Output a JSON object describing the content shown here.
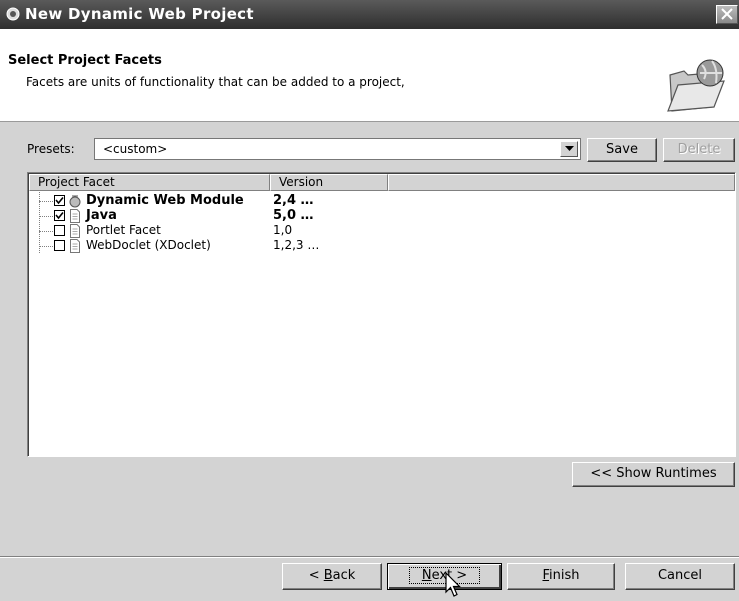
{
  "window": {
    "title": "New Dynamic Web Project"
  },
  "header": {
    "title": "Select Project Facets",
    "description": "Facets are units of functionality that can be added to a project,"
  },
  "presets": {
    "label": "Presets:",
    "value": "<custom>",
    "save_label": "Save",
    "delete_label": "Delete"
  },
  "table": {
    "columns": [
      "Project Facet",
      "Version"
    ],
    "rows": [
      {
        "name": "Dynamic Web Module",
        "version": "2,4 …",
        "checked": true,
        "bold": true,
        "icon": "web-module-icon"
      },
      {
        "name": "Java",
        "version": "5,0 …",
        "checked": true,
        "bold": true,
        "icon": "file-icon"
      },
      {
        "name": "Portlet Facet",
        "version": "1,0",
        "checked": false,
        "bold": false,
        "icon": "file-icon"
      },
      {
        "name": "WebDoclet (XDoclet)",
        "version": "1,2,3 …",
        "checked": false,
        "bold": false,
        "icon": "file-icon"
      }
    ]
  },
  "show_runtimes_label": "<< Show Runtimes",
  "buttons": {
    "back": {
      "prefix": "< ",
      "mnemonic": "B",
      "rest": "ack"
    },
    "next": {
      "mnemonic": "N",
      "rest": "ext >"
    },
    "finish": {
      "mnemonic": "F",
      "rest": "inish"
    },
    "cancel": {
      "label": "Cancel"
    }
  }
}
